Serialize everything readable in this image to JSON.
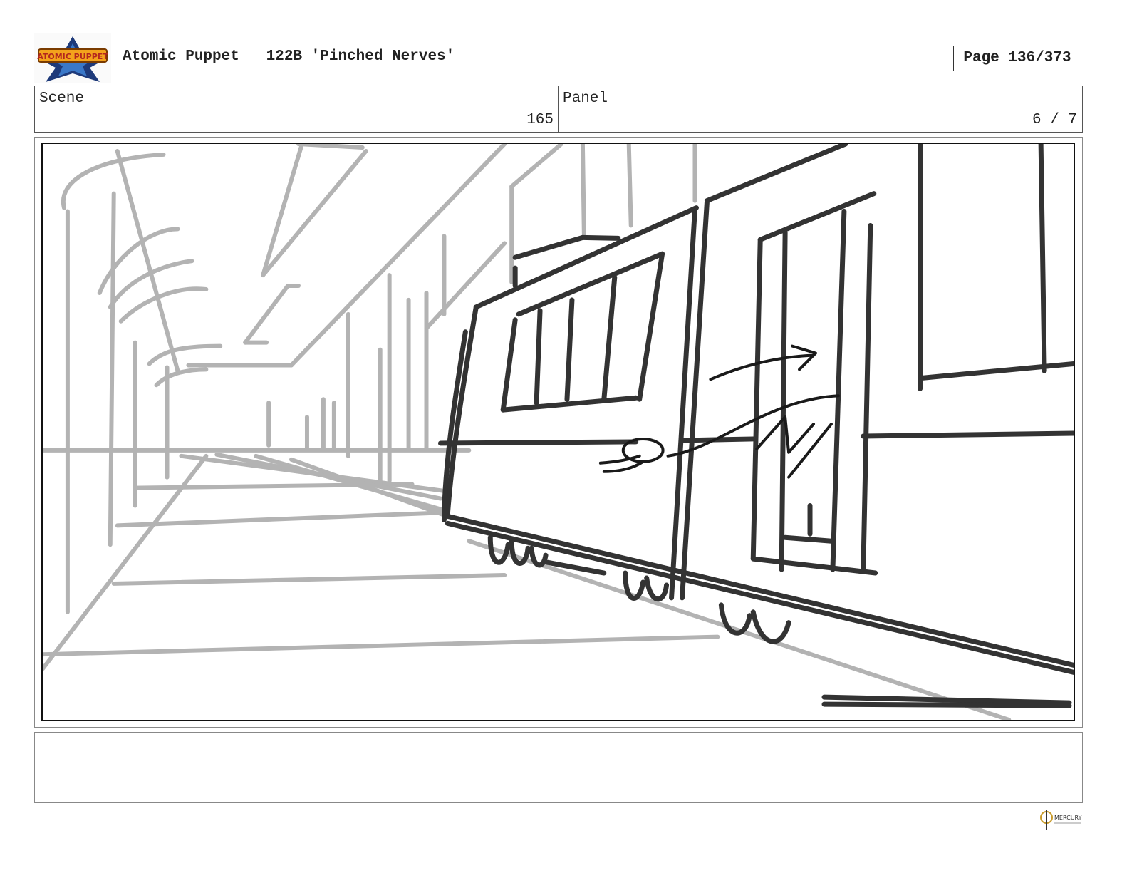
{
  "header": {
    "logo_text": "ATOMIC PUPPET",
    "show_title": "Atomic Puppet",
    "episode": "122B 'Pinched Nerves'",
    "page_indicator": "Page 136/373"
  },
  "info": {
    "scene_label": "Scene",
    "scene_value": "165",
    "panel_label": "Panel",
    "panel_value": "6 / 7"
  },
  "notes": {
    "text": ""
  },
  "footer": {
    "logo_text": "MERCURY"
  },
  "colors": {
    "sketch_dark": "#333333",
    "sketch_light": "#b3b3b3",
    "frame": "#111111"
  }
}
